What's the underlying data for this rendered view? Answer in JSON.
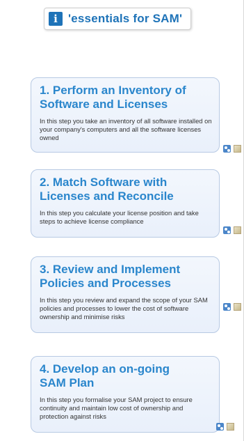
{
  "header": {
    "title": "'essentials for SAM'",
    "icon": "info-icon",
    "icon_glyph": "i"
  },
  "steps": [
    {
      "title_line1": "1. Perform an Inventory of",
      "title_line2": "Software and Licenses",
      "description": "In this step you take an inventory of all software installed on your company's computers and all the software licenses owned"
    },
    {
      "title_line1": "2. Match Software with",
      "title_line2": "Licenses and Reconcile",
      "description": "In this step you calculate your license position and take steps to achieve license compliance"
    },
    {
      "title_line1": "3. Review and Implement",
      "title_line2": "Policies and Processes",
      "description": "In this step you review and expand the scope of your SAM policies and processes to lower the cost of software ownership and minimise risks"
    },
    {
      "title_line1": "4. Develop an on-going",
      "title_line2": "SAM Plan",
      "description": "In this step you formalise your SAM project to ensure continuity and maintain low cost of ownership and protection against risks"
    }
  ],
  "step_icons": [
    "share-icon",
    "note-icon"
  ],
  "colors": {
    "accent": "#1e73b8",
    "card_title": "#2a86cc",
    "card_border": "#b7c9e3"
  }
}
